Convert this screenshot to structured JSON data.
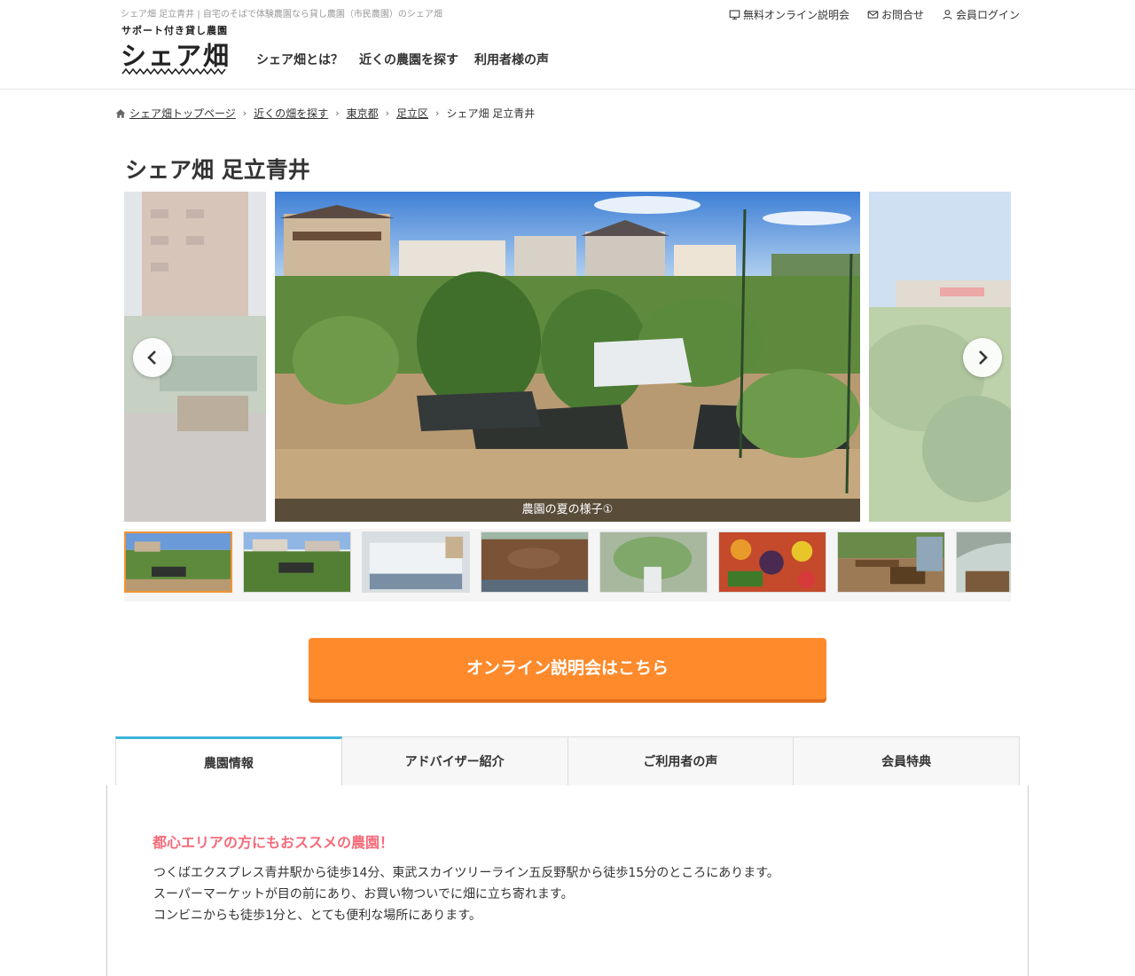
{
  "header": {
    "tagline": "シェア畑 足立青井 | 自宅のそばで体験農園なら貸し農園（市民農園）のシェア畑",
    "logo_sub": "サポート付き貸し農園",
    "logo_main": "シェア畑",
    "nav": [
      "シェア畑とは？",
      "近くの農園を探す",
      "利用者様の声"
    ],
    "util": [
      {
        "icon": "monitor-icon",
        "label": "無料オンライン説明会"
      },
      {
        "icon": "mail-icon",
        "label": "お問合せ"
      },
      {
        "icon": "user-icon",
        "label": "会員ログイン"
      }
    ]
  },
  "breadcrumb": {
    "items": [
      "シェア畑トップページ",
      "近くの畑を探す",
      "東京都",
      "足立区"
    ],
    "current": "シェア畑 足立青井"
  },
  "page": {
    "title": "シェア畑 足立青井"
  },
  "slider": {
    "caption": "農園の夏の様子①",
    "prev_icon": "chevron-left-icon",
    "next_icon": "chevron-right-icon"
  },
  "cta": {
    "label": "オンライン説明会はこちら"
  },
  "tabs": [
    "農園情報",
    "アドバイザー紹介",
    "ご利用者の声",
    "会員特典"
  ],
  "farm_info": {
    "heading": "都心エリアの方にもおススメの農園！",
    "lines": [
      "つくばエクスプレス青井駅から徒歩14分、東武スカイツリーライン五反野駅から徒歩15分のところにあります。",
      "スーパーマーケットが目の前にあり、お買い物ついでに畑に立ち寄れます。",
      "コンビニからも徒歩1分と、とても便利な場所にあります。"
    ]
  },
  "colors": {
    "accent_orange": "#fe8a2c",
    "tab_active_border": "#3cb4dc",
    "heading_pink": "#f56b7a"
  }
}
